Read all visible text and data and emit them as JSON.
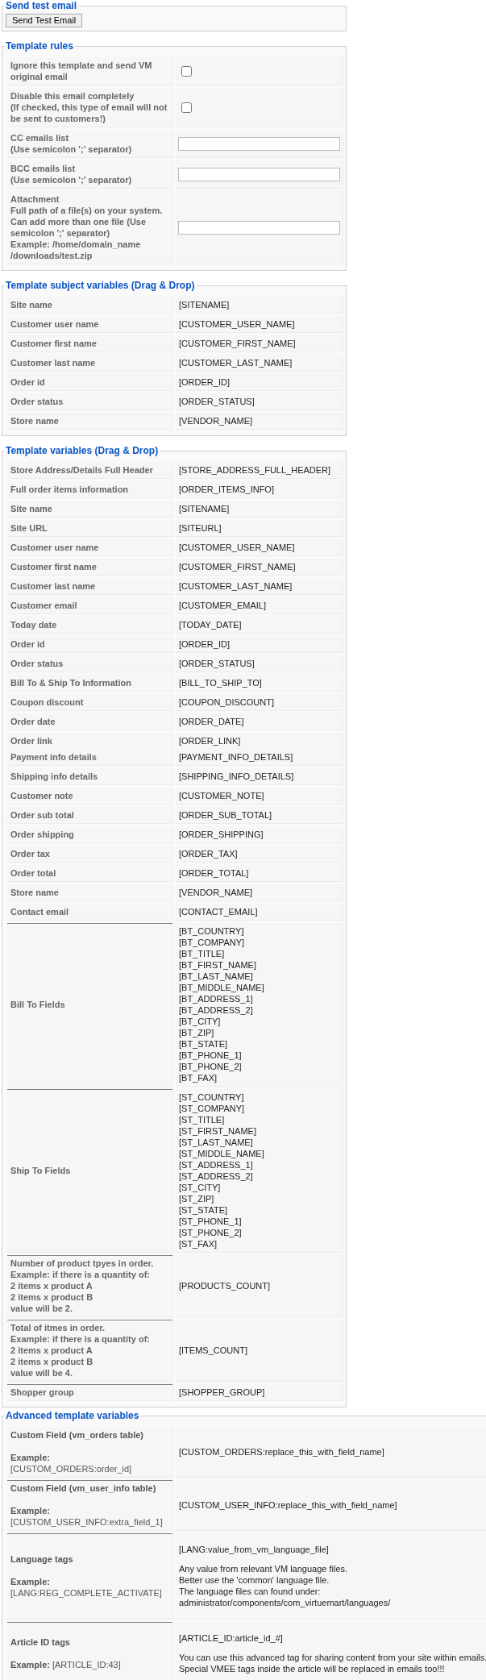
{
  "send_test_email": {
    "title": "Send test email",
    "button": "Send Test Email"
  },
  "template_rules": {
    "title": "Template rules",
    "rows": [
      {
        "kind": "checkbox",
        "label": "Ignore this template and send VM original email",
        "checked": false
      },
      {
        "kind": "checkbox",
        "label": "Disable this email completely\n(If checked, this type of email will not be sent to customers!)",
        "checked": false
      },
      {
        "kind": "text",
        "label": "CC emails list\n(Use semicolon ';' separator)"
      },
      {
        "kind": "text",
        "label": "BCC emails list\n(Use semicolon ';' separator)"
      },
      {
        "kind": "text",
        "label": "Attachment\nFull path of a file(s) on your system. Can add more than one file (Use semicolon ';' separator)\nExample: /home/domain_name\n/downloads/test.zip"
      }
    ]
  },
  "template_subject_variables": {
    "title": "Template subject variables (Drag & Drop)",
    "rows": [
      {
        "kind": "single",
        "label": "Site name",
        "value": "[SITENAME]"
      },
      {
        "kind": "single",
        "label": "Customer user name",
        "value": "[CUSTOMER_USER_NAME]"
      },
      {
        "kind": "single",
        "label": "Customer first name",
        "value": "[CUSTOMER_FIRST_NAME]"
      },
      {
        "kind": "single",
        "label": "Customer last name",
        "value": "[CUSTOMER_LAST_NAME]"
      },
      {
        "kind": "single",
        "label": "Order id",
        "value": "[ORDER_ID]"
      },
      {
        "kind": "single",
        "label": "Order status",
        "value": "[ORDER_STATUS]"
      },
      {
        "kind": "single",
        "label": "Store name",
        "value": "[VENDOR_NAME]"
      }
    ]
  },
  "template_variables": {
    "title": "Template variables (Drag & Drop)",
    "rows": [
      {
        "kind": "single",
        "label": "Store Address/Details Full Header",
        "value": "[STORE_ADDRESS_FULL_HEADER]"
      },
      {
        "kind": "single",
        "label": "Full order items information",
        "value": "[ORDER_ITEMS_INFO]"
      },
      {
        "kind": "single",
        "label": "Site name",
        "value": "[SITENAME]"
      },
      {
        "kind": "single",
        "label": "Site URL",
        "value": "[SITEURL]"
      },
      {
        "kind": "single",
        "label": "Customer user name",
        "value": "[CUSTOMER_USER_NAME]"
      },
      {
        "kind": "single",
        "label": "Customer first name",
        "value": "[CUSTOMER_FIRST_NAME]"
      },
      {
        "kind": "single",
        "label": "Customer last name",
        "value": "[CUSTOMER_LAST_NAME]"
      },
      {
        "kind": "single",
        "label": "Customer email",
        "value": "[CUSTOMER_EMAIL]"
      },
      {
        "kind": "single",
        "label": "Today date",
        "value": "[TODAY_DATE]"
      },
      {
        "kind": "single",
        "label": "Order id",
        "value": "[ORDER_ID]"
      },
      {
        "kind": "single",
        "label": "Order status",
        "value": "[ORDER_STATUS]"
      },
      {
        "kind": "single",
        "label": "Bill To & Ship To Information",
        "value": "[BILL_TO_SHIP_TO]"
      },
      {
        "kind": "single",
        "label": "Coupon discount",
        "value": "[COUPON_DISCOUNT]"
      },
      {
        "kind": "single",
        "label": "Order date",
        "value": "[ORDER_DATE]"
      },
      {
        "kind": "pair",
        "labels": [
          "Order link",
          "Payment info details"
        ],
        "values": [
          "[ORDER_LINK]",
          "[PAYMENT_INFO_DETAILS]"
        ]
      },
      {
        "kind": "single",
        "label": "Shipping info details",
        "value": "[SHIPPING_INFO_DETAILS]"
      },
      {
        "kind": "single",
        "label": "Customer note",
        "value": "[CUSTOMER_NOTE]"
      },
      {
        "kind": "single",
        "label": "Order sub total",
        "value": "[ORDER_SUB_TOTAL]"
      },
      {
        "kind": "single",
        "label": "Order shipping",
        "value": "[ORDER_SHIPPING]"
      },
      {
        "kind": "single",
        "label": "Order tax",
        "value": "[ORDER_TAX]"
      },
      {
        "kind": "single",
        "label": "Order total",
        "value": "[ORDER_TOTAL]"
      },
      {
        "kind": "single",
        "label": "Store name",
        "value": "[VENDOR_NAME]"
      },
      {
        "kind": "single",
        "label": "Contact email",
        "value": "[CONTACT_EMAIL]"
      },
      {
        "kind": "list",
        "ruled": true,
        "label": "Bill To Fields",
        "values": [
          "[BT_COUNTRY]",
          "[BT_COMPANY]",
          "[BT_TITLE]",
          "[BT_FIRST_NAME]",
          "[BT_LAST_NAME]",
          "[BT_MIDDLE_NAME]",
          "[BT_ADDRESS_1]",
          "[BT_ADDRESS_2]",
          "[BT_CITY]",
          "[BT_ZIP]",
          "[BT_STATE]",
          "[BT_PHONE_1]",
          "[BT_PHONE_2]",
          "[BT_FAX]"
        ]
      },
      {
        "kind": "list",
        "ruled": true,
        "label": "Ship To Fields",
        "values": [
          "[ST_COUNTRY]",
          "[ST_COMPANY]",
          "[ST_TITLE]",
          "[ST_FIRST_NAME]",
          "[ST_LAST_NAME]",
          "[ST_MIDDLE_NAME]",
          "[ST_ADDRESS_1]",
          "[ST_ADDRESS_2]",
          "[ST_CITY]",
          "[ST_ZIP]",
          "[ST_STATE]",
          "[ST_PHONE_1]",
          "[ST_PHONE_2]",
          "[ST_FAX]"
        ]
      },
      {
        "kind": "single",
        "ruled": true,
        "label": "Number of product tpyes in order.\nExample: if there is a quantity of:\n2 items x product A\n2 items x product B\nvalue will be 2.",
        "value": "[PRODUCTS_COUNT]"
      },
      {
        "kind": "single",
        "ruled": true,
        "label": "Total of itmes in order.\nExample: if there is a quantity of:\n2 items x product A\n2 items x product B\nvalue will be 4.",
        "value": "[ITEMS_COUNT]"
      },
      {
        "kind": "single",
        "ruled": true,
        "label": "Shopper group",
        "value": "[SHOPPER_GROUP]"
      }
    ]
  },
  "advanced_template_variables": {
    "title": "Advanced template variables",
    "rows": [
      {
        "title": "Custom Field (vm_orders table)",
        "example": "**Example:** [CUSTOM_ORDERS:order_id]",
        "tag": "[CUSTOM_ORDERS:replace_this_with_field_name]"
      },
      {
        "ruled": true,
        "title": "Custom Field (vm_user_info table)",
        "example": "**Example:** [CUSTOM_USER_INFO:extra_field_1]",
        "tag": "[CUSTOM_USER_INFO:replace_this_with_field_name]"
      },
      {
        "ruled": true,
        "title": "Language tags",
        "example": "**Example:** [LANG:REG_COMPLETE_ACTIVATE]",
        "tag": "[LANG:value_from_vm_language_file]",
        "note": "Any value from relevant VM language files.\nBetter use the 'common' language file.\nThe language files can found under:\nadministrator/components/com_virtuemart/languages/"
      },
      {
        "ruled": true,
        "title": "Article ID tags",
        "example": "**Example:** [ARTICLE_ID:43]",
        "tag": "[ARTICLE_ID:article_id_#]",
        "note": "You can use this advanced tag for sharing content from your site within emails.\nSpecial VMEE tags inside the article will be replaced in emails too!!!"
      }
    ]
  }
}
